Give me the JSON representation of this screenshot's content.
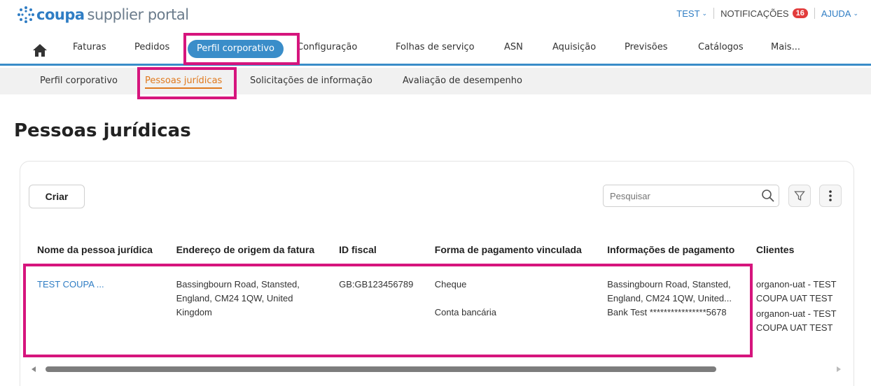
{
  "header": {
    "logo_brand": "coupa",
    "logo_product": "supplier portal",
    "user_menu": "TEST",
    "notifications_label": "NOTIFICAÇÕES",
    "notifications_count": "16",
    "help_menu": "AJUDA"
  },
  "nav": {
    "items": [
      "Faturas",
      "Pedidos",
      "Perfil corporativo",
      "Configuração",
      "Folhas de serviço",
      "ASN",
      "Aquisição",
      "Previsões",
      "Catálogos",
      "Mais..."
    ],
    "active": "Perfil corporativo"
  },
  "subnav": {
    "items": [
      "Perfil corporativo",
      "Pessoas jurídicas",
      "Solicitações de informação",
      "Avaliação de desempenho"
    ],
    "active": "Pessoas jurídicas"
  },
  "page": {
    "title": "Pessoas jurídicas"
  },
  "toolbar": {
    "create_label": "Criar",
    "search_placeholder": "Pesquisar"
  },
  "table": {
    "columns": [
      "Nome da pessoa jurídica",
      "Endereço de origem da fatura",
      "ID fiscal",
      "Forma de pagamento vinculada",
      "Informações de pagamento",
      "Clientes"
    ],
    "row": {
      "name": "TEST COUPA ...",
      "address_l1": "Bassingbourn Road, Stansted,",
      "address_l2": "England, CM24 1QW, United",
      "address_l3": "Kingdom",
      "tax_id": "GB:GB123456789",
      "payment_method_1": "Cheque",
      "payment_method_2": "Conta bancária",
      "payment_info_1a": "Bassingbourn Road, Stansted,",
      "payment_info_1b": "England, CM24 1QW, United...",
      "payment_info_2": "Bank Test ****************5678",
      "client_1a": "organon-uat - TEST",
      "client_1b": "COUPA UAT TEST",
      "client_2a": "organon-uat - TEST",
      "client_2b": "COUPA UAT TEST"
    }
  },
  "colors": {
    "brand_blue": "#2f7dc4",
    "nav_blue": "#3a8dc9",
    "highlight_pink": "#d6157d",
    "subnav_active_orange": "#e0791e",
    "badge_red": "#e23c3c"
  }
}
